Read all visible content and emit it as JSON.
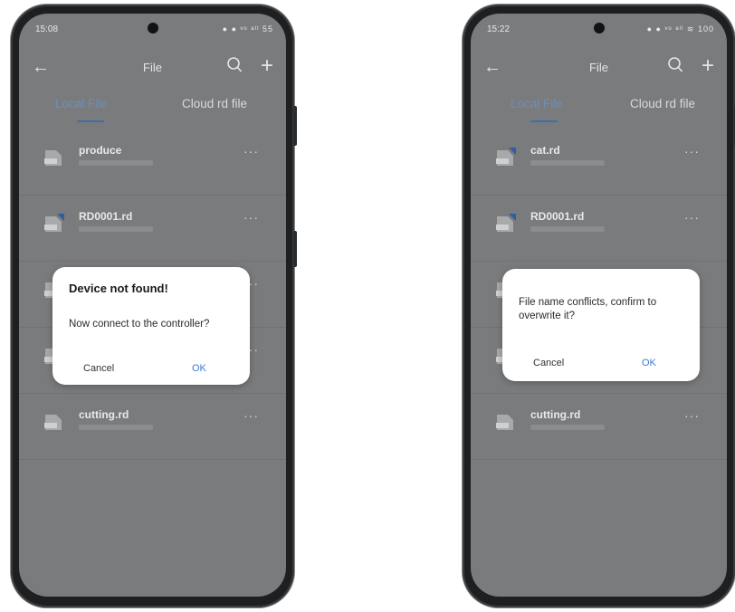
{
  "screens": [
    {
      "status_time": "15:08",
      "status_icons": "● ● ᵛᵒ ᵃˡˡ 55",
      "appbar": {
        "title": "File"
      },
      "tabs": {
        "local": "Local File",
        "cloud": "Cloud rd file"
      },
      "files": [
        {
          "name": "produce",
          "cloud": false
        },
        {
          "name": "RD0001.rd",
          "cloud": true
        },
        {
          "name": "",
          "cloud": false
        },
        {
          "name": "",
          "cloud": false
        },
        {
          "name": "cutting.rd",
          "cloud": false
        }
      ],
      "dialog": {
        "title": "Device not found!",
        "message": "Now connect to the controller?",
        "cancel": "Cancel",
        "ok": "OK"
      }
    },
    {
      "status_time": "15:22",
      "status_icons": "● ● ᵛᵒ ᵃˡˡ ≋ 100",
      "appbar": {
        "title": "File"
      },
      "tabs": {
        "local": "Local File",
        "cloud": "Cloud rd file"
      },
      "files": [
        {
          "name": "cat.rd",
          "cloud": true
        },
        {
          "name": "RD0001.rd",
          "cloud": true
        },
        {
          "name": "",
          "cloud": false
        },
        {
          "name": "",
          "cloud": false
        },
        {
          "name": "cutting.rd",
          "cloud": false
        }
      ],
      "dialog": {
        "title": "",
        "message": "File name conflicts, confirm to overwrite it?",
        "cancel": "Cancel",
        "ok": "OK"
      }
    }
  ],
  "colors": {
    "overlay_bg": "#7a7b7d",
    "accent": "#3a7bd5",
    "tab_active": "#6d8fb7"
  },
  "icons": [
    "back-arrow-icon",
    "search-icon",
    "plus-icon",
    "file-icon",
    "cloud-badge-icon",
    "more-icon"
  ]
}
